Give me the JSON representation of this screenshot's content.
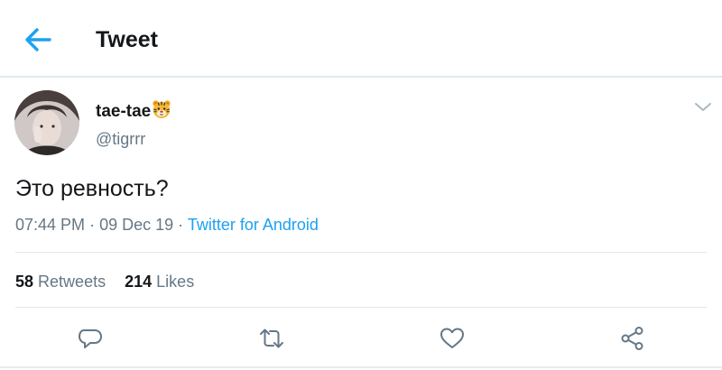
{
  "header": {
    "title": "Tweet",
    "back_icon": "back-arrow-icon",
    "accent": "#1da1f2"
  },
  "tweet": {
    "author": {
      "display_name": "tae-tae",
      "emoji": "tiger-face-emoji",
      "handle": "@tigrrr"
    },
    "text": "Это ревность?",
    "time": "07:44 PM",
    "date": "09 Dec 19",
    "separator": "·",
    "source": "Twitter for Android"
  },
  "stats": {
    "retweets_count": "58",
    "retweets_label": "Retweets",
    "likes_count": "214",
    "likes_label": "Likes"
  },
  "actions": [
    "reply-icon",
    "retweet-icon",
    "like-icon",
    "share-icon"
  ],
  "colors": {
    "text": "#14171a",
    "secondary": "#657786",
    "link": "#1da1f2",
    "divider": "#e1e8ed"
  }
}
